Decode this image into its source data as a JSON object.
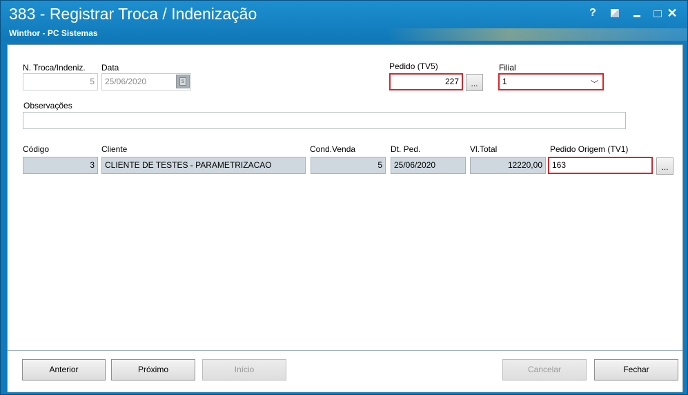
{
  "window": {
    "title": "383 - Registrar Troca / Indenização",
    "subtitle": "Winthor - PC Sistemas",
    "controls": {
      "help": "?",
      "close": "✕"
    }
  },
  "form": {
    "n_troca": {
      "label": "N. Troca/Indeniz.",
      "value": "5"
    },
    "data": {
      "label": "Data",
      "value": "25/06/2020"
    },
    "pedido_tv5": {
      "label": "Pedido (TV5)",
      "value": "227",
      "button": "..."
    },
    "filial": {
      "label": "Filial",
      "value": "1"
    },
    "observacoes": {
      "label": "Observações",
      "value": ""
    },
    "codigo": {
      "label": "Código",
      "value": "3"
    },
    "cliente": {
      "label": "Cliente",
      "value": "CLIENTE DE TESTES - PARAMETRIZACAO"
    },
    "cond_venda": {
      "label": "Cond.Venda",
      "value": "5"
    },
    "dt_ped": {
      "label": "Dt. Ped.",
      "value": "25/06/2020"
    },
    "vl_total": {
      "label": "Vl.Total",
      "value": "12220,00"
    },
    "pedido_origem": {
      "label": "Pedido Origem (TV1)",
      "value": "163",
      "button": "..."
    }
  },
  "buttons": {
    "anterior": "Anterior",
    "proximo": "Próximo",
    "inicio": "Início",
    "cancelar": "Cancelar",
    "fechar": "Fechar"
  },
  "colors": {
    "titlebar": "#0f78b8",
    "highlight": "#d9252b",
    "readonly_field": "#cfd8df"
  }
}
